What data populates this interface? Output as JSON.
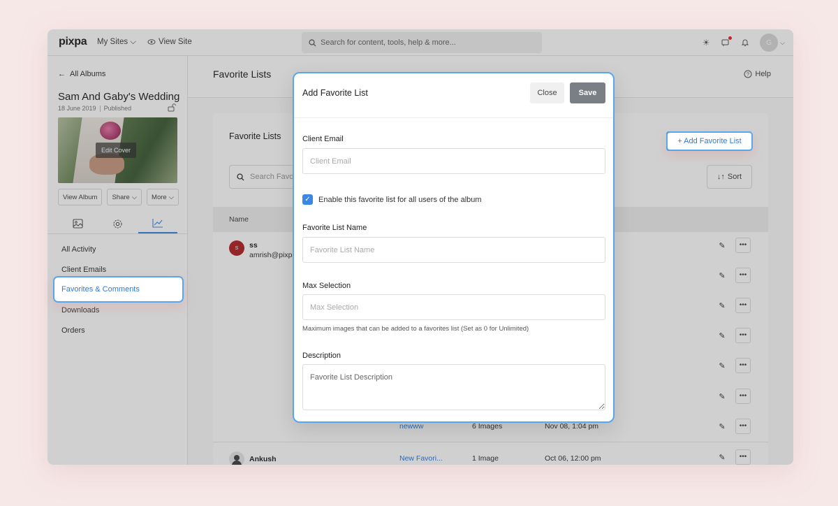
{
  "topbar": {
    "logo": "pixpa",
    "my_sites": "My Sites",
    "view_site": "View Site",
    "search_placeholder": "Search for content, tools, help & more...",
    "avatar_initial": "G"
  },
  "sidebar": {
    "back_label": "All Albums",
    "album_title": "Sam And Gaby's Wedding",
    "album_date": "18 June 2019",
    "album_status": "Published",
    "edit_cover": "Edit Cover",
    "buttons": [
      "View Album",
      "Share",
      "More"
    ],
    "nav": [
      "All Activity",
      "Client Emails",
      "Favorites & Comments",
      "Downloads",
      "Orders"
    ]
  },
  "main": {
    "title": "Favorite Lists",
    "help": "Help",
    "panel_title": "Favorite Lists",
    "add_button": "+ Add Favorite List",
    "search_placeholder": "Search Favorite Lists",
    "sort": "Sort",
    "col_name": "Name",
    "rows": [
      {
        "name": "ss",
        "email": "amrish@pixpa.com",
        "initials": "S"
      },
      {
        "list": "newww",
        "images": "6 Images",
        "date": "Nov 08, 1:04 pm"
      },
      {
        "name": "Ankush",
        "list": "New Favori...",
        "images": "1 Image",
        "date": "Oct 06, 12:00 pm"
      }
    ]
  },
  "modal": {
    "title": "Add Favorite List",
    "close": "Close",
    "save": "Save",
    "email_label": "Client Email",
    "email_placeholder": "Client Email",
    "checkbox_label": "Enable this favorite list for all users of the album",
    "name_label": "Favorite List Name",
    "name_placeholder": "Favorite List Name",
    "max_label": "Max Selection",
    "max_placeholder": "Max Selection",
    "max_hint": "Maximum images that can be added to a favorites list (Set as 0 for Unlimited)",
    "desc_label": "Description",
    "desc_placeholder": "Favorite List Description"
  },
  "colors": {
    "accent": "#3b87e6",
    "highlight": "#58a6ee",
    "save_button": "#7a7f86"
  }
}
